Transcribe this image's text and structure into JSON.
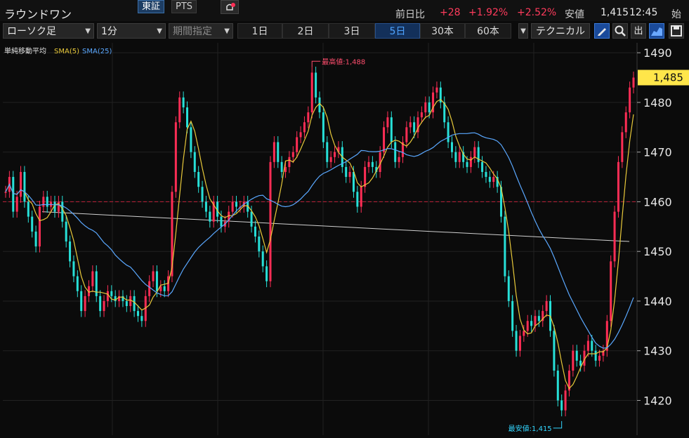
{
  "header": {
    "stock_name": "ラウンドワン",
    "market_tabs": [
      "東証",
      "PTS"
    ],
    "prev_close_label": "前日比",
    "change": "+28",
    "change_pct": "+1.92%",
    "change_pct2": "+2.52%",
    "low_label": "安値",
    "low_value": "1,415",
    "time": "12:45",
    "open_label": "始値"
  },
  "toolbar": {
    "chart_type": "ローソク足",
    "interval": "1分",
    "period_select": "期間指定",
    "periods": [
      "1日",
      "2日",
      "3日",
      "5日",
      "30本",
      "60本"
    ],
    "active_period": "5日",
    "technical_label": "テクニカル",
    "output_label": "出"
  },
  "colors": {
    "up": "#ff2d55",
    "down": "#27e0d8",
    "sma5": "#e8c93a",
    "sma25": "#5aa8ff",
    "price_tag": "#ffe64a",
    "high_marker": "#ff4d6d",
    "low_marker": "#33d6ff",
    "ref_line": "#c0203a"
  },
  "chart_data": {
    "type": "line",
    "title": "",
    "legend": {
      "indicator": "単純移動平均",
      "sma5_label": "SMA(5)",
      "sma25_label": "SMA(25)",
      "placement": "top-left"
    },
    "ylim": [
      1413,
      1492
    ],
    "yticks": [
      1420,
      1430,
      1440,
      1450,
      1460,
      1470,
      1480,
      1490
    ],
    "current_price": 1485,
    "current_price_label": "1,485",
    "reference_price": 1460,
    "high": {
      "value": 1488,
      "label": "最高値:1,488"
    },
    "low": {
      "value": 1415,
      "label": "最安値:1,415"
    },
    "trendline": {
      "start": 1458,
      "end": 1452
    },
    "grid": true,
    "series": [
      {
        "name": "price",
        "values": [
          1462,
          1465,
          1458,
          1461,
          1466,
          1460,
          1457,
          1454,
          1451,
          1459,
          1461,
          1459,
          1460,
          1458,
          1460,
          1456,
          1452,
          1448,
          1445,
          1442,
          1438,
          1441,
          1443,
          1446,
          1441,
          1438,
          1440,
          1442,
          1441,
          1440,
          1441,
          1440,
          1439,
          1441,
          1438,
          1437,
          1436,
          1441,
          1444,
          1446,
          1442,
          1443,
          1442,
          1445,
          1462,
          1476,
          1481,
          1479,
          1475,
          1470,
          1466,
          1463,
          1460,
          1458,
          1456,
          1460,
          1457,
          1455,
          1456,
          1458,
          1460,
          1459,
          1459,
          1460,
          1458,
          1455,
          1453,
          1450,
          1447,
          1444,
          1468,
          1472,
          1468,
          1466,
          1467,
          1469,
          1470,
          1473,
          1474,
          1476,
          1478,
          1486,
          1481,
          1478,
          1472,
          1468,
          1469,
          1470,
          1471,
          1467,
          1465,
          1466,
          1462,
          1459,
          1463,
          1467,
          1468,
          1467,
          1466,
          1470,
          1475,
          1477,
          1472,
          1468,
          1469,
          1472,
          1475,
          1476,
          1474,
          1477,
          1478,
          1480,
          1478,
          1482,
          1483,
          1480,
          1476,
          1472,
          1470,
          1468,
          1470,
          1468,
          1467,
          1469,
          1471,
          1468,
          1466,
          1465,
          1464,
          1465,
          1463,
          1457,
          1445,
          1440,
          1434,
          1430,
          1433,
          1434,
          1436,
          1435,
          1437,
          1436,
          1438,
          1440,
          1434,
          1426,
          1420,
          1418,
          1422,
          1426,
          1430,
          1428,
          1427,
          1430,
          1432,
          1430,
          1428,
          1429,
          1430,
          1436,
          1448,
          1458,
          1468,
          1474,
          1478,
          1483,
          1485
        ]
      }
    ]
  }
}
